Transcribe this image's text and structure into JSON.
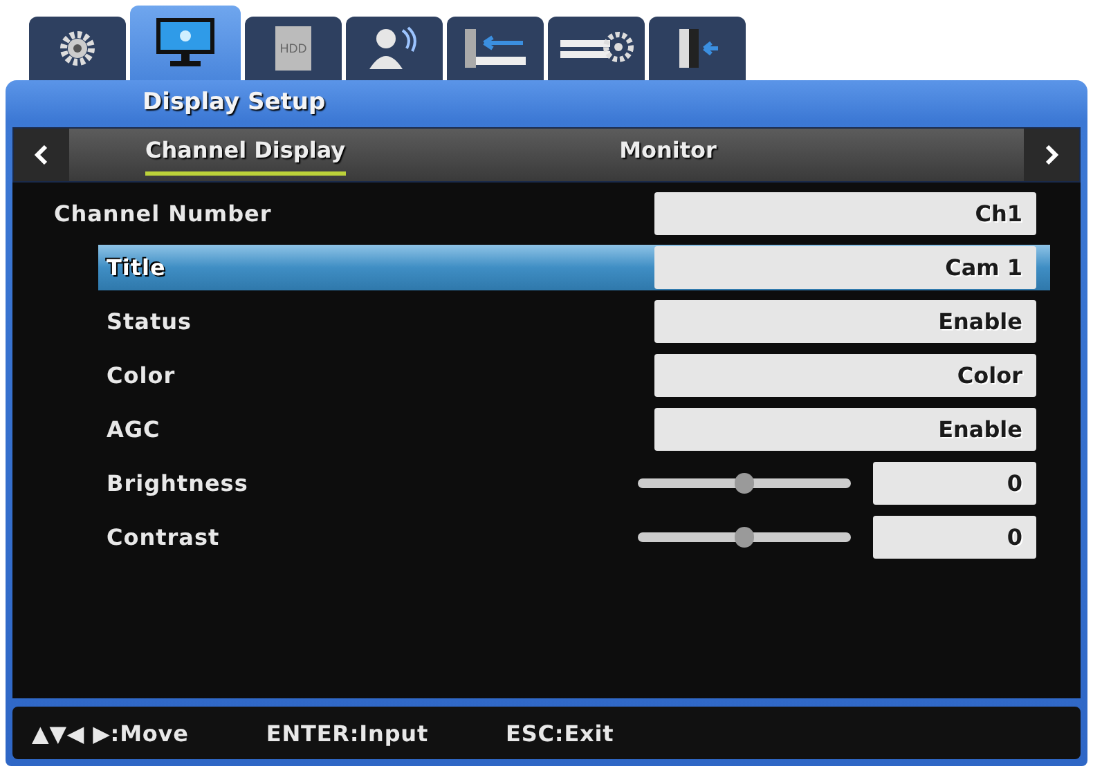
{
  "tabs": [
    {
      "kind": "gear",
      "selected": false
    },
    {
      "kind": "monitor",
      "selected": true
    },
    {
      "kind": "disk",
      "icon_text": "HDD",
      "selected": false
    },
    {
      "kind": "person",
      "selected": false
    },
    {
      "kind": "network",
      "selected": false
    },
    {
      "kind": "device",
      "selected": false
    },
    {
      "kind": "exit",
      "selected": false
    }
  ],
  "window": {
    "title": "Display Setup"
  },
  "subtabs": [
    {
      "label": "Channel Display",
      "selected": true
    },
    {
      "label": "Monitor",
      "selected": false
    }
  ],
  "channel": {
    "label": "Channel Number",
    "value": "Ch1"
  },
  "settings": [
    {
      "kind": "field",
      "label": "Title",
      "value": "Cam 1",
      "selected": true
    },
    {
      "kind": "field",
      "label": "Status",
      "value": "Enable",
      "selected": false
    },
    {
      "kind": "field",
      "label": "Color",
      "value": "Color",
      "selected": false
    },
    {
      "kind": "field",
      "label": "AGC",
      "value": "Enable",
      "selected": false
    },
    {
      "kind": "slider",
      "label": "Brightness",
      "value": "0",
      "level": 0.5,
      "selected": false
    },
    {
      "kind": "slider",
      "label": "Contrast",
      "value": "0",
      "level": 0.5,
      "selected": false
    }
  ],
  "footer": [
    "▲▼◀ ▶:Move",
    "ENTER:Input",
    "ESC:Exit"
  ]
}
